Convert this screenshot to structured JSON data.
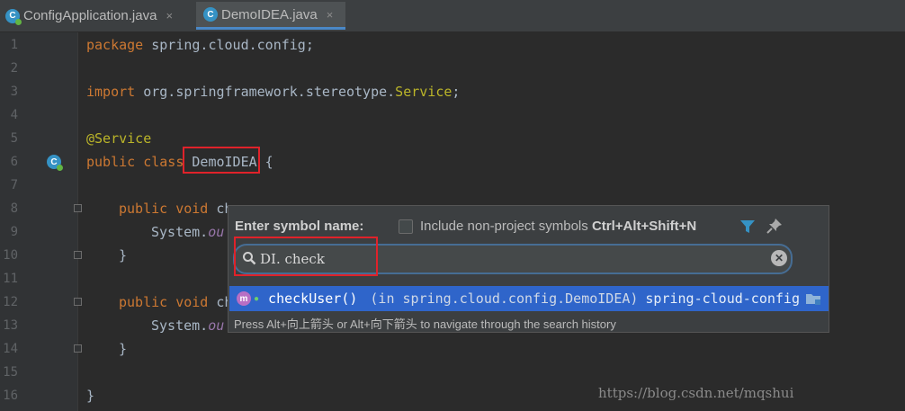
{
  "tabs": [
    {
      "label": "ConfigApplication.java",
      "close": "×",
      "icon": "spring-class-icon"
    },
    {
      "label": "DemoIDEA.java",
      "close": "×",
      "icon": "class-icon",
      "active": true
    }
  ],
  "line_numbers": [
    "1",
    "2",
    "3",
    "4",
    "5",
    "6",
    "7",
    "8",
    "9",
    "10",
    "11",
    "12",
    "13",
    "14",
    "15",
    "16"
  ],
  "code": {
    "l1_kw": "package",
    "l1_rest": " spring.cloud.config;",
    "l3_kw": "import",
    "l3_rest": " org.springframework.stereotype.",
    "l3_svc": "Service",
    "l3_end": ";",
    "l5_ann": "@Service",
    "l6_kw": "public class ",
    "l6_name": "DemoIDEA",
    "l6_end": " {",
    "l8_kw": "public void ",
    "l8_rest": "ch",
    "l9_a": "System.",
    "l9_b": "ou",
    "l10": "}",
    "l12_kw": "public void ",
    "l12_rest": "ch",
    "l13_a": "System.",
    "l13_b": "ou",
    "l14": "}",
    "l16": "}"
  },
  "popup": {
    "title": "Enter symbol name:",
    "checkbox_label": "Include non-project symbols",
    "shortcut": "Ctrl+Alt+Shift+N",
    "search_value": "DI. check",
    "result": {
      "name": "checkUser()",
      "location": "(in spring.cloud.config.DemoIDEA)",
      "module": "spring-cloud-config",
      "icon_letter": "m"
    },
    "hint": "Press Alt+向上箭头 or Alt+向下箭头 to navigate through the search history"
  },
  "watermark": "https://blog.csdn.net/mqshui",
  "colors": {
    "accent_red": "#e0222a",
    "selection": "#2f65ca",
    "keyword": "#cc7832"
  }
}
